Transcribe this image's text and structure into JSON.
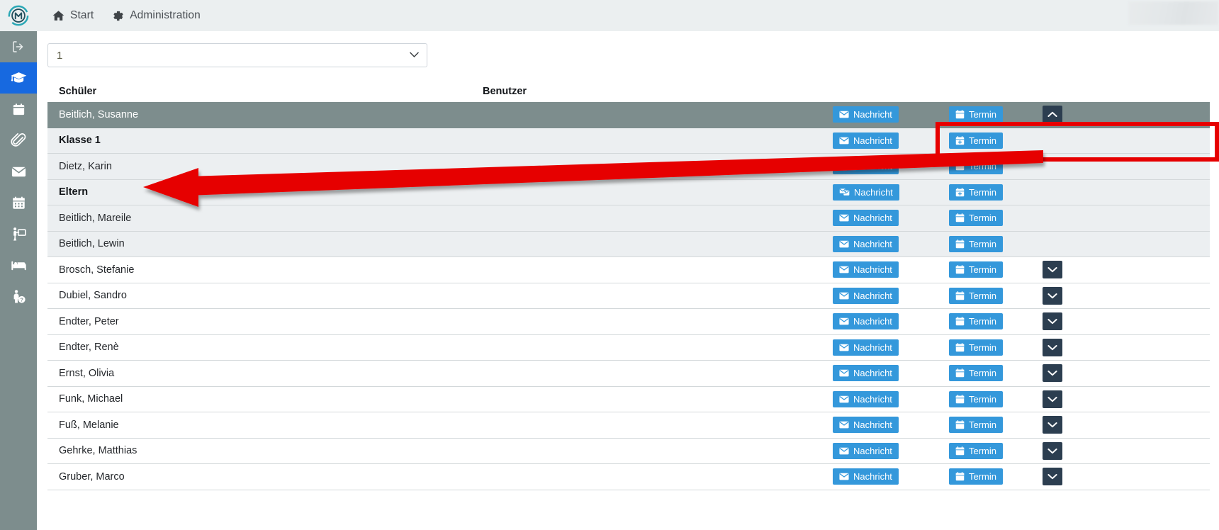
{
  "app": {
    "logo_icon": "app-logo-icon",
    "topnav": [
      {
        "label": "Start",
        "icon": "home-icon"
      },
      {
        "label": "Administration",
        "icon": "gear-icon"
      }
    ]
  },
  "sidebar": {
    "items": [
      {
        "icon": "logout-icon",
        "name": "logout",
        "active": false
      },
      {
        "icon": "graduation-cap-icon",
        "name": "students",
        "active": true
      },
      {
        "icon": "clipboard-icon",
        "name": "clipboard",
        "active": false
      },
      {
        "icon": "paperclip-icon",
        "name": "attachments",
        "active": false
      },
      {
        "icon": "envelope-icon",
        "name": "messages",
        "active": false
      },
      {
        "icon": "calendar-icon",
        "name": "calendar",
        "active": false
      },
      {
        "icon": "presentation-icon",
        "name": "lessons",
        "active": false
      },
      {
        "icon": "bed-icon",
        "name": "boarding",
        "active": false
      },
      {
        "icon": "person-info-icon",
        "name": "person-info",
        "active": false
      }
    ]
  },
  "filter": {
    "selected": "1",
    "options": [
      "1"
    ]
  },
  "table": {
    "columns": {
      "schueler": "Schüler",
      "benutzer": "Benutzer"
    },
    "buttons": {
      "nachricht": "Nachricht",
      "termin": "Termin"
    },
    "rows": [
      {
        "name": "Beitlich, Susanne",
        "type": "student",
        "state": "selected",
        "msg_icon": "envelope-icon",
        "date_icon": "calendar-icon",
        "caret": "chevron-up-icon"
      },
      {
        "name": "Klasse 1",
        "type": "group",
        "state": "shaded",
        "msg_icon": "envelope-icon",
        "date_icon": "calendar-plus-icon",
        "caret": null
      },
      {
        "name": "Dietz, Karin",
        "type": "person",
        "state": "shaded",
        "msg_icon": "envelope-icon",
        "date_icon": "calendar-icon",
        "caret": null
      },
      {
        "name": "Eltern",
        "type": "group",
        "state": "shaded",
        "msg_icon": "envelopes-group-icon",
        "date_icon": "calendar-plus-icon",
        "caret": null
      },
      {
        "name": "Beitlich, Mareile",
        "type": "person",
        "state": "shaded",
        "msg_icon": "envelope-icon",
        "date_icon": "calendar-icon",
        "caret": null
      },
      {
        "name": "Beitlich, Lewin",
        "type": "person",
        "state": "shaded",
        "msg_icon": "envelope-icon",
        "date_icon": "calendar-icon",
        "caret": null
      },
      {
        "name": "Brosch, Stefanie",
        "type": "person",
        "state": "plain",
        "msg_icon": "envelope-icon",
        "date_icon": "calendar-icon",
        "caret": "chevron-down-icon"
      },
      {
        "name": "Dubiel, Sandro",
        "type": "person",
        "state": "plain",
        "msg_icon": "envelope-icon",
        "date_icon": "calendar-icon",
        "caret": "chevron-down-icon"
      },
      {
        "name": "Endter, Peter",
        "type": "person",
        "state": "plain",
        "msg_icon": "envelope-icon",
        "date_icon": "calendar-icon",
        "caret": "chevron-down-icon"
      },
      {
        "name": "Endter, Renè",
        "type": "person",
        "state": "plain",
        "msg_icon": "envelope-icon",
        "date_icon": "calendar-icon",
        "caret": "chevron-down-icon"
      },
      {
        "name": "Ernst, Olivia",
        "type": "person",
        "state": "plain",
        "msg_icon": "envelope-icon",
        "date_icon": "calendar-icon",
        "caret": "chevron-down-icon"
      },
      {
        "name": "Funk, Michael",
        "type": "person",
        "state": "plain",
        "msg_icon": "envelope-icon",
        "date_icon": "calendar-icon",
        "caret": "chevron-down-icon"
      },
      {
        "name": "Fuß, Melanie",
        "type": "person",
        "state": "plain",
        "msg_icon": "envelope-icon",
        "date_icon": "calendar-icon",
        "caret": "chevron-down-icon"
      },
      {
        "name": "Gehrke, Matthias",
        "type": "person",
        "state": "plain",
        "msg_icon": "envelope-icon",
        "date_icon": "calendar-icon",
        "caret": "chevron-down-icon"
      },
      {
        "name": "Gruber, Marco",
        "type": "person",
        "state": "plain",
        "msg_icon": "envelope-icon",
        "date_icon": "calendar-icon",
        "caret": "chevron-down-icon"
      }
    ]
  },
  "annotation": {
    "highlight_color": "#e60000",
    "highlight_target": "Beitlich, Susanne",
    "arrow_target": "Eltern"
  },
  "colors": {
    "accent_blue": "#3498db",
    "rail_bg": "#7d8d8d",
    "rail_active": "#1769e0",
    "caret_button": "#2c3e50",
    "row_shaded": "#eceff1",
    "topbar_bg": "#ebeff0"
  }
}
